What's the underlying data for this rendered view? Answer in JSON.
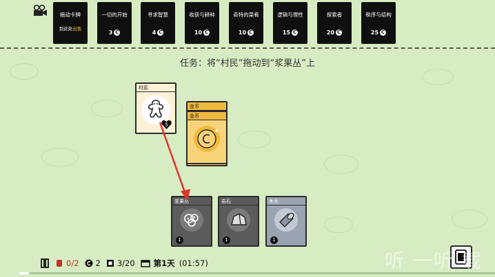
{
  "topbar": {
    "packs": [
      {
        "name": "拖动卡牌",
        "sub_pre": "到此处",
        "sub_hl": "出售",
        "cost": ""
      },
      {
        "name": "一切的开始",
        "cost": "3"
      },
      {
        "name": "寻求智慧",
        "cost": "4"
      },
      {
        "name": "收获与耕种",
        "cost": "10"
      },
      {
        "name": "奇特的菜肴",
        "cost": "10"
      },
      {
        "name": "逻辑与理性",
        "cost": "15"
      },
      {
        "name": "探索者",
        "cost": "20"
      },
      {
        "name": "秩序与结构",
        "cost": "25"
      }
    ],
    "coin_symbol": "C"
  },
  "quest": {
    "text": "任务：将“村民”拖动到“浆果丛”上"
  },
  "cards": {
    "villager": {
      "title": "村民",
      "health": "5"
    },
    "coin_back": {
      "title": "金币"
    },
    "coin_front": {
      "title": "金币"
    },
    "berry_bush": {
      "title": "浆果丛",
      "count": "1"
    },
    "rock": {
      "title": "岩石",
      "count": "1"
    },
    "wood": {
      "title": "木头",
      "count": "1"
    }
  },
  "status": {
    "food": "0/2",
    "coins": "2",
    "cards": "3/20",
    "day": "第1天",
    "time": "(01:57)",
    "day_progress": 0.02
  },
  "watermark": "听 一听 载",
  "colors": {
    "background": "#d7ecc2",
    "red": "#c0302b",
    "coin": "#f3b93a"
  }
}
